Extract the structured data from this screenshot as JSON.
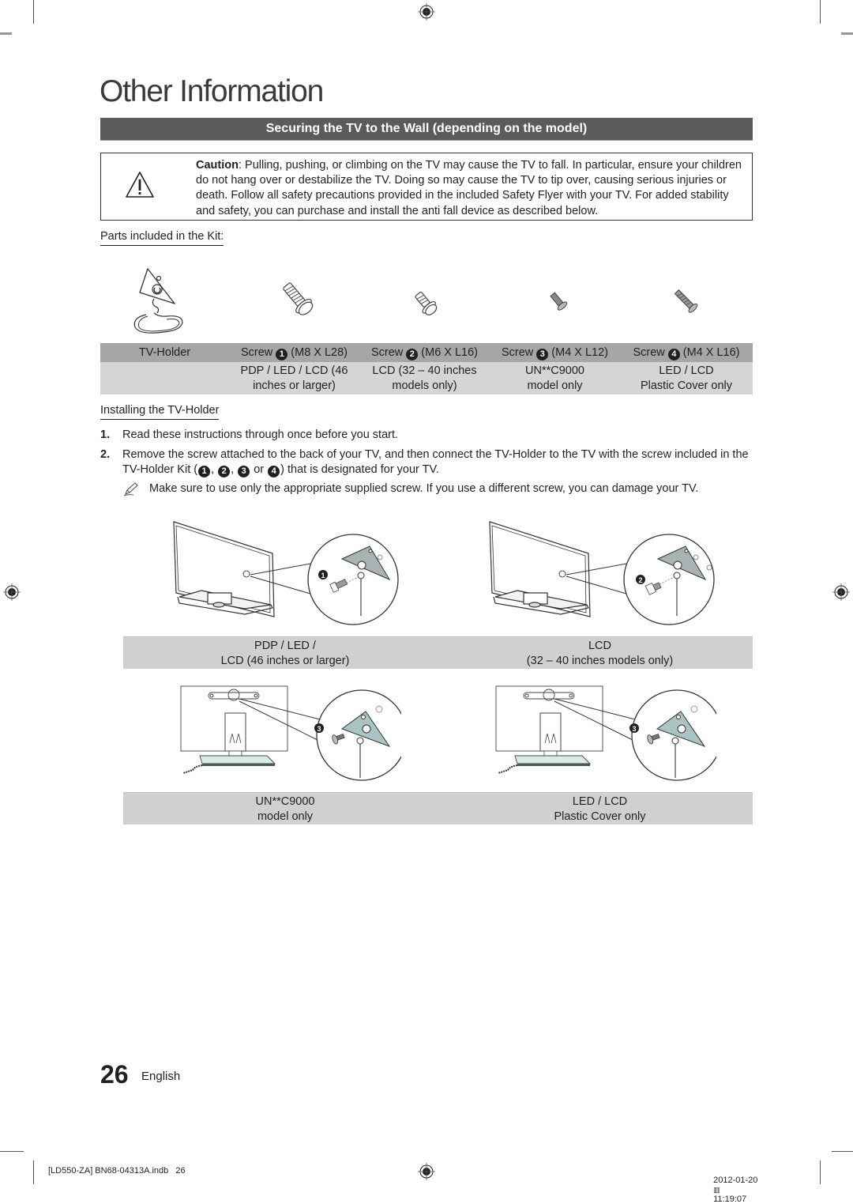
{
  "page": {
    "title": "Other Information",
    "section_title": "Securing the TV to the Wall (depending on the model)",
    "page_number": "26",
    "language": "English"
  },
  "caution": {
    "icon": "warning-triangle-icon",
    "label": "Caution",
    "text": ": Pulling, pushing, or climbing on the TV may cause the TV to fall. In particular, ensure your children do not hang over or destabilize the TV. Doing so may cause the TV to tip over, causing serious injuries or death. Follow all safety precautions provided in the included Safety Flyer with your TV. For added stability and safety, you can purchase and install the anti fall device as described below."
  },
  "kit": {
    "heading": "Parts included in the Kit:",
    "parts": [
      {
        "name": "TV-Holder",
        "spec": "",
        "models_line1": "",
        "models_line2": "",
        "icon": "tv-holder-icon"
      },
      {
        "name": "Screw",
        "number": "1",
        "spec": "(M8 X L28)",
        "models_line1": "PDP / LED / LCD (46",
        "models_line2": "inches or larger)",
        "icon": "screw-m8-icon"
      },
      {
        "name": "Screw",
        "number": "2",
        "spec": "(M6 X L16)",
        "models_line1": "LCD (32 – 40 inches",
        "models_line2": "models only)",
        "icon": "screw-m6-icon"
      },
      {
        "name": "Screw",
        "number": "3",
        "spec": "(M4 X L12)",
        "models_line1": "UN**C9000",
        "models_line2": "model only",
        "icon": "screw-m4-short-icon"
      },
      {
        "name": "Screw",
        "number": "4",
        "spec": "(M4 X L16)",
        "models_line1": "LED / LCD",
        "models_line2": "Plastic Cover only",
        "icon": "screw-m4-long-icon"
      }
    ]
  },
  "install": {
    "heading": "Installing the TV-Holder",
    "steps": [
      {
        "num": "1.",
        "text": "Read these instructions through once before you start."
      },
      {
        "num": "2.",
        "text_before": "Remove the screw attached to the back of your TV, and then connect the TV-Holder to the TV with the screw included in the TV-Holder Kit (",
        "bullets": [
          "1",
          "2",
          "3",
          "4"
        ],
        "sep1": ", ",
        "sep2": ", ",
        "sep3": " or ",
        "text_after": ") that is designated for your TV."
      }
    ],
    "note": "Make sure to use only the appropriate supplied screw. If you use a different screw, you can damage your TV."
  },
  "figures": [
    {
      "screw_number": "1",
      "caption_line1": "PDP / LED /",
      "caption_line2": "LCD (46 inches or larger)"
    },
    {
      "screw_number": "2",
      "caption_line1": "LCD",
      "caption_line2": "(32 – 40 inches models only)"
    },
    {
      "screw_number": "3",
      "caption_line1": "UN**C9000",
      "caption_line2": "model only"
    },
    {
      "screw_number": "3",
      "caption_line1": "LED / LCD",
      "caption_line2": "Plastic Cover only"
    }
  ],
  "slug": {
    "file": "[LD550-ZA] BN68-04313A.indb   26",
    "date": "2012-01-20",
    "time_glyph": "▥",
    "time": "11:19:07"
  },
  "colors": {
    "section_bar": "#5b5b5b",
    "kit_header": "#a6a6a6",
    "kit_body": "#d5d5d5",
    "caption_bar": "#d0d0d0",
    "bracket": "#a9b3b3"
  }
}
